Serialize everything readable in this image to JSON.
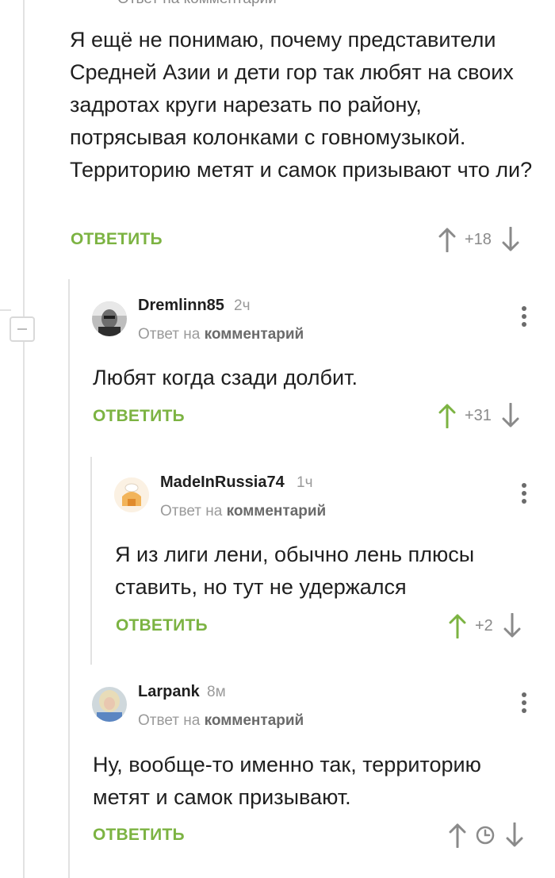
{
  "top_comment": {
    "cut_text": "Ответ на комментарий",
    "text": "Я ещё не понимаю, почему представители Средней Азии и дети гор так любят на своих задротах круги нарезать по району, потрясывая колонками с говномузыкой. Территорию метят и самок призывают что ли?",
    "reply_label": "ОТВЕТИТЬ",
    "score": "+18"
  },
  "comments": [
    {
      "author": "Dremlinn85",
      "age": "2ч",
      "reply_prefix": "Ответ на",
      "reply_target": "комментарий",
      "text": "Любят когда сзади долбит.",
      "reply_label": "ОТВЕТИТЬ",
      "score": "+31"
    },
    {
      "author": "MadeInRussia74",
      "age": "1ч",
      "reply_prefix": "Ответ на",
      "reply_target": "комментарий",
      "text": "Я из лиги лени, обычно лень плюсы ставить, но тут не удержался",
      "reply_label": "ОТВЕТИТЬ",
      "score": "+2"
    },
    {
      "author": "Larpank",
      "age": "8м",
      "reply_prefix": "Ответ на",
      "reply_target": "комментарий",
      "text": "Ну, вообще-то именно так, территорию метят и самок призывают.",
      "reply_label": "ОТВЕТИТЬ",
      "score_hidden_icon": "clock-icon"
    }
  ],
  "colors": {
    "accent_green": "#7cb342",
    "upvoted_green": "#7cb342",
    "arrow_gray": "#8a8a8a",
    "thread_line": "#e2e2e2"
  }
}
